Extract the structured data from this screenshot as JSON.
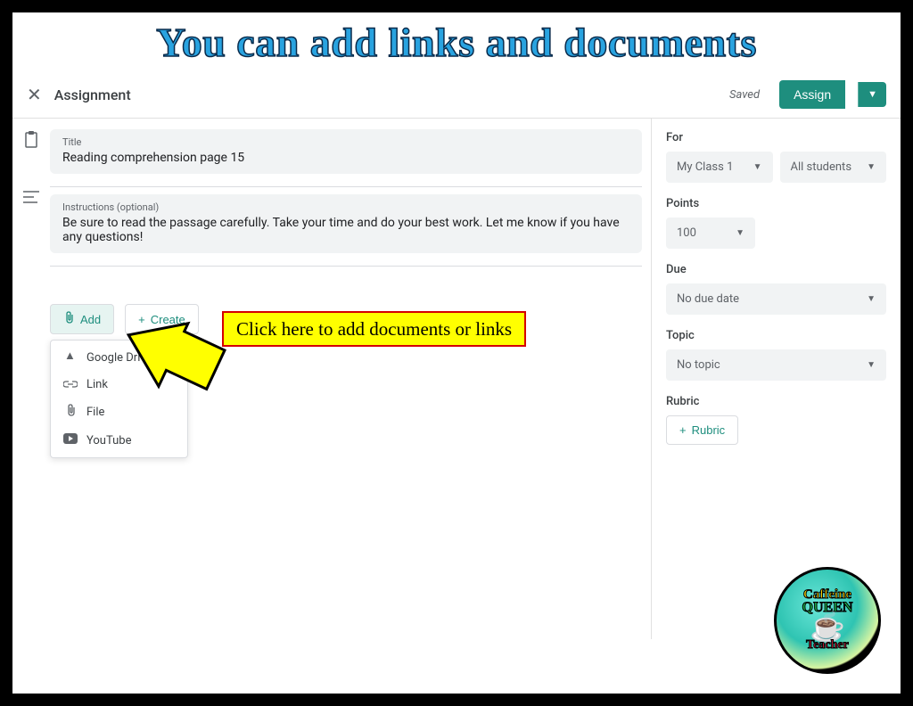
{
  "banner": "You can add links and documents",
  "topbar": {
    "title": "Assignment",
    "saved": "Saved",
    "assign": "Assign"
  },
  "main": {
    "title_label": "Title",
    "title_value": "Reading comprehension page 15",
    "instructions_label": "Instructions (optional)",
    "instructions_value": "Be sure to read the passage carefully. Take your time and do your best work. Let me know if you have any questions!",
    "add_label": "Add",
    "create_label": "Create",
    "dropdown": {
      "drive": "Google Drive",
      "link": "Link",
      "file": "File",
      "youtube": "YouTube"
    }
  },
  "side": {
    "for_label": "For",
    "class": "My Class 1",
    "students": "All students",
    "points_label": "Points",
    "points_value": "100",
    "due_label": "Due",
    "due_value": "No due date",
    "topic_label": "Topic",
    "topic_value": "No topic",
    "rubric_label": "Rubric",
    "rubric_btn": "Rubric"
  },
  "callout": "Click here to add documents or links",
  "logo": {
    "l1": "Caffeine",
    "l2": "QUEEN",
    "l3": "Teacher"
  }
}
